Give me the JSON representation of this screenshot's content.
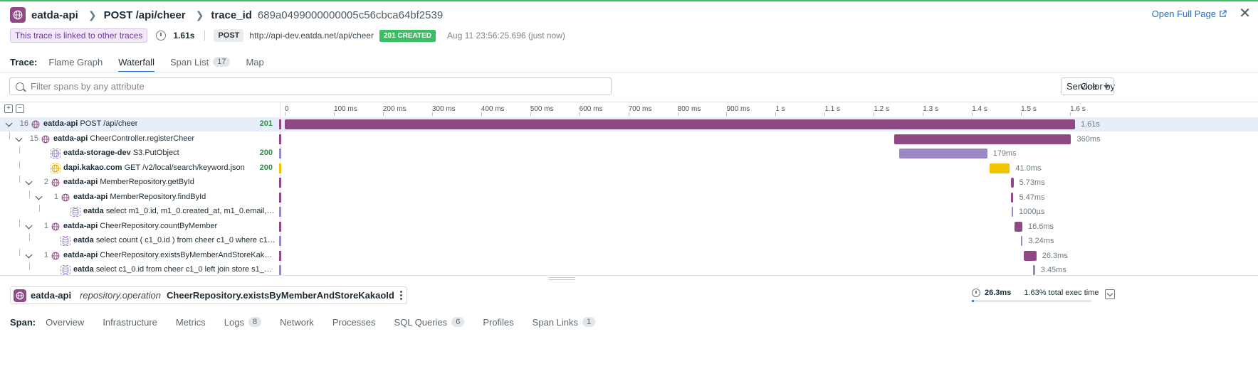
{
  "header": {
    "service": "eatda-api",
    "resource": "POST /api/cheer",
    "trace_id_label": "trace_id",
    "trace_id": "689a0499000000005c56cbca64bf2539",
    "open_full_page": "Open Full Page"
  },
  "meta": {
    "linked_text": "This trace is linked to other traces",
    "duration": "1.61s",
    "method": "POST",
    "url": "http://api-dev.eatda.net/api/cheer",
    "status": "201 CREATED",
    "timestamp": "Aug 11 23:56:25.696 (just now)"
  },
  "trace_tabs": {
    "label": "Trace:",
    "items": [
      {
        "label": "Flame Graph"
      },
      {
        "label": "Waterfall",
        "active": true
      },
      {
        "label": "Span List",
        "count": "17"
      },
      {
        "label": "Map"
      }
    ]
  },
  "filter": {
    "placeholder": "Filter spans by any attribute"
  },
  "color_by": {
    "label": "Color by",
    "value": "Service"
  },
  "axis": {
    "max_s": 1.61,
    "ticks": [
      {
        "label": "0",
        "v": 0
      },
      {
        "label": "100 ms",
        "v": 0.1
      },
      {
        "label": "200 ms",
        "v": 0.2
      },
      {
        "label": "300 ms",
        "v": 0.3
      },
      {
        "label": "400 ms",
        "v": 0.4
      },
      {
        "label": "500 ms",
        "v": 0.5
      },
      {
        "label": "600 ms",
        "v": 0.6
      },
      {
        "label": "700 ms",
        "v": 0.7
      },
      {
        "label": "800 ms",
        "v": 0.8
      },
      {
        "label": "900 ms",
        "v": 0.9
      },
      {
        "label": "1 s",
        "v": 1.0
      },
      {
        "label": "1.1 s",
        "v": 1.1
      },
      {
        "label": "1.2 s",
        "v": 1.2
      },
      {
        "label": "1.3 s",
        "v": 1.3
      },
      {
        "label": "1.4 s",
        "v": 1.4
      },
      {
        "label": "1.5 s",
        "v": 1.5
      },
      {
        "label": "1.6 s",
        "v": 1.6
      }
    ]
  },
  "colors": {
    "api": "#8f4a86",
    "storage": "#9b86c6",
    "kakao": "#f5c400",
    "db": "#9b86c6"
  },
  "spans": [
    {
      "depth": 0,
      "count": "16",
      "kind": "api",
      "service": "eatda-api",
      "resource": "POST /api/cheer",
      "code": "201",
      "start": 0,
      "dur": 1.61,
      "label": "1.61s",
      "selected": true,
      "caret": true
    },
    {
      "depth": 1,
      "count": "15",
      "kind": "api",
      "service": "eatda-api",
      "resource": "CheerController.registerCheer",
      "code": "",
      "start": 1.242,
      "dur": 0.36,
      "label": "360ms",
      "caret": true
    },
    {
      "depth": 2,
      "count": "",
      "kind": "storage",
      "service": "eatda-storage-dev",
      "resource": "S3.PutObject",
      "code": "200",
      "start": 1.252,
      "dur": 0.179,
      "label": "179ms"
    },
    {
      "depth": 2,
      "count": "",
      "kind": "kakao",
      "service": "dapi.kakao.com",
      "resource": "GET /v2/local/search/keyword.json",
      "code": "200",
      "start": 1.436,
      "dur": 0.041,
      "label": "41.0ms"
    },
    {
      "depth": 2,
      "count": "2",
      "kind": "api",
      "service": "eatda-api",
      "resource": "MemberRepository.getById",
      "code": "",
      "start": 1.479,
      "dur": 0.00573,
      "label": "5.73ms",
      "caret": true
    },
    {
      "depth": 3,
      "count": "1",
      "kind": "api",
      "service": "eatda-api",
      "resource": "MemberRepository.findById",
      "code": "",
      "start": 1.479,
      "dur": 0.00547,
      "label": "5.47ms",
      "caret": true
    },
    {
      "depth": 4,
      "count": "",
      "kind": "db",
      "service": "eatda",
      "resource": "select m1_0.id, m1_0.created_at, m1_0.email, m1_...",
      "code": "",
      "start": 1.481,
      "dur": 0.001,
      "label": "1000µs"
    },
    {
      "depth": 2,
      "count": "1",
      "kind": "api",
      "service": "eatda-api",
      "resource": "CheerRepository.countByMember",
      "code": "",
      "start": 1.486,
      "dur": 0.0166,
      "label": "16.6ms",
      "caret": true
    },
    {
      "depth": 3,
      "count": "",
      "kind": "db",
      "service": "eatda",
      "resource": "select count ( c1_0.id ) from cheer c1_0 where c1_0....",
      "code": "",
      "start": 1.5,
      "dur": 0.00324,
      "label": "3.24ms"
    },
    {
      "depth": 2,
      "count": "1",
      "kind": "api",
      "service": "eatda-api",
      "resource": "CheerRepository.existsByMemberAndStoreKakaoId",
      "code": "",
      "start": 1.505,
      "dur": 0.0263,
      "label": "26.3ms",
      "caret": true
    },
    {
      "depth": 3,
      "count": "",
      "kind": "db",
      "service": "eatda",
      "resource": "select c1_0.id from cheer c1_0 left join store s1_0 on ...",
      "code": "",
      "start": 1.525,
      "dur": 0.00345,
      "label": "3.45ms"
    }
  ],
  "detail": {
    "service": "eatda-api",
    "operation": "repository.operation",
    "resource": "CheerRepository.existsByMemberAndStoreKakaoId",
    "exec_time": "26.3ms",
    "exec_pct": "1.63% total exec time",
    "exec_fraction": 0.0163
  },
  "span_tabs": {
    "label": "Span:",
    "items": [
      {
        "label": "Overview"
      },
      {
        "label": "Infrastructure"
      },
      {
        "label": "Metrics"
      },
      {
        "label": "Logs",
        "count": "8"
      },
      {
        "label": "Network"
      },
      {
        "label": "Processes"
      },
      {
        "label": "SQL Queries",
        "count": "6"
      },
      {
        "label": "Profiles"
      },
      {
        "label": "Span Links",
        "count": "1"
      }
    ]
  }
}
